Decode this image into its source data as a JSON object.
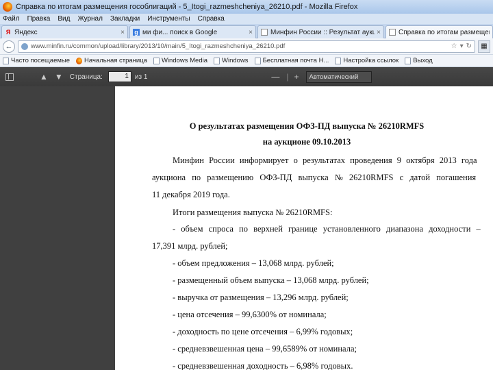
{
  "window": {
    "title": "Справка по итогам размещения гособлигаций - 5_Itogi_razmeshcheniya_26210.pdf - Mozilla Firefox"
  },
  "menu": [
    "Файл",
    "Правка",
    "Вид",
    "Журнал",
    "Закладки",
    "Инструменты",
    "Справка"
  ],
  "tabs": [
    {
      "label": "Яндекс",
      "favicon": "yandex-icon",
      "active": false
    },
    {
      "label": "ми фи... поиск в Google",
      "favicon": "google-icon",
      "active": false
    },
    {
      "label": "Минфин России :: Результат аукциона ...",
      "favicon": "page-icon",
      "active": false
    },
    {
      "label": "Справка по итогам размещения госо...",
      "favicon": "page-icon",
      "active": true
    }
  ],
  "address": {
    "url": "www.minfin.ru/common/upload/library/2013/10/main/5_Itogi_razmeshcheniya_26210.pdf"
  },
  "bookmarks": [
    {
      "label": "Часто посещаемые",
      "icon": "folder-icon"
    },
    {
      "label": "Начальная страница",
      "icon": "firefox-icon"
    },
    {
      "label": "Windows Media",
      "icon": "page-icon"
    },
    {
      "label": "Windows",
      "icon": "page-icon"
    },
    {
      "label": "Бесплатная почта H...",
      "icon": "page-icon"
    },
    {
      "label": "Настройка ссылок",
      "icon": "page-icon"
    },
    {
      "label": "Выход",
      "icon": "page-icon"
    }
  ],
  "pdf_toolbar": {
    "page_label": "Страница:",
    "page_value": "1",
    "page_total": "из 1",
    "zoom_minus": "—",
    "zoom_plus": "+",
    "zoom_value": "Автоматический"
  },
  "document": {
    "title_line1": "О результатах размещения ОФЗ-ПД выпуска № 26210RMFS",
    "title_line2": "на аукционе 09.10.2013",
    "lines": [
      "Минфин России информирует о результатах проведения 9 октября 2013 года",
      "аукциона по размещению ОФЗ-ПД выпуска № 26210RMFS с датой погашения",
      "11 декабря 2019 года.",
      "Итоги размещения выпуска № 26210RMFS:",
      "- объем спроса по верхней границе установленного диапазона доходности –",
      "17,391 млрд. рублей;",
      "- объем предложения – 13,068 млрд. рублей;",
      "- размещенный объем выпуска – 13,068 млрд. рублей;",
      "- выручка от размещения – 13,296 млрд. рублей;",
      "- цена отсечения – 99,6300% от номинала;",
      "- доходность по цене отсечения – 6,99% годовых;",
      "- средневзвешенная цена – 99,6589% от номинала;",
      "- средневзвешенная доходность – 6,98% годовых."
    ]
  }
}
